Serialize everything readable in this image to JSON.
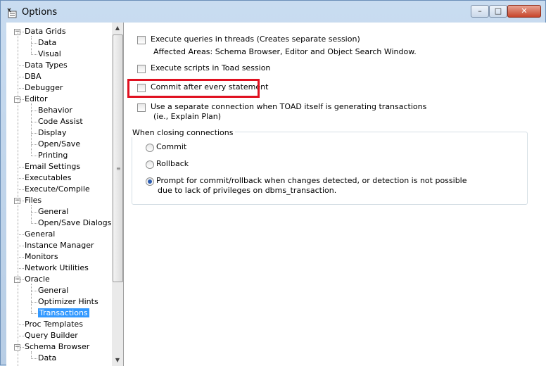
{
  "window": {
    "title": "Options",
    "minimize": "–",
    "maximize": "□",
    "close": "✕"
  },
  "tree": {
    "items": [
      {
        "label": "Data Grids",
        "level": 0,
        "expander": "−"
      },
      {
        "label": "Data",
        "level": 1
      },
      {
        "label": "Visual",
        "level": 1
      },
      {
        "label": "Data Types",
        "level": 0
      },
      {
        "label": "DBA",
        "level": 0
      },
      {
        "label": "Debugger",
        "level": 0
      },
      {
        "label": "Editor",
        "level": 0,
        "expander": "−"
      },
      {
        "label": "Behavior",
        "level": 1
      },
      {
        "label": "Code Assist",
        "level": 1
      },
      {
        "label": "Display",
        "level": 1
      },
      {
        "label": "Open/Save",
        "level": 1
      },
      {
        "label": "Printing",
        "level": 1
      },
      {
        "label": "Email Settings",
        "level": 0
      },
      {
        "label": "Executables",
        "level": 0
      },
      {
        "label": "Execute/Compile",
        "level": 0
      },
      {
        "label": "Files",
        "level": 0,
        "expander": "−"
      },
      {
        "label": "General",
        "level": 1
      },
      {
        "label": "Open/Save Dialogs",
        "level": 1
      },
      {
        "label": "General",
        "level": 0
      },
      {
        "label": "Instance Manager",
        "level": 0
      },
      {
        "label": "Monitors",
        "level": 0
      },
      {
        "label": "Network Utilities",
        "level": 0
      },
      {
        "label": "Oracle",
        "level": 0,
        "expander": "−"
      },
      {
        "label": "General",
        "level": 1
      },
      {
        "label": "Optimizer Hints",
        "level": 1
      },
      {
        "label": "Transactions",
        "level": 1,
        "selected": true
      },
      {
        "label": "Proc Templates",
        "level": 0
      },
      {
        "label": "Query Builder",
        "level": 0
      },
      {
        "label": "Schema Browser",
        "level": 0,
        "expander": "−"
      },
      {
        "label": "Data",
        "level": 1
      }
    ],
    "scroll_up": "▲",
    "scroll_down": "▼"
  },
  "panel": {
    "threads_label": "Execute queries in threads (Creates separate session)",
    "threads_note": "Affected Areas: Schema Browser, Editor and Object Search Window.",
    "toad_session_label": "Execute scripts in Toad session",
    "commit_every_label": "Commit after every statement",
    "separate_conn_label": "Use a separate connection when TOAD itself is generating transactions",
    "separate_conn_note": "(ie., Explain Plan)",
    "closing_group_label": "When closing connections",
    "radio_commit": "Commit",
    "radio_rollback": "Rollback",
    "radio_prompt_line1": "Prompt for commit/rollback when changes detected, or detection is not possible",
    "radio_prompt_line2": "due to lack of privileges on dbms_transaction.",
    "selected_radio": "prompt"
  }
}
